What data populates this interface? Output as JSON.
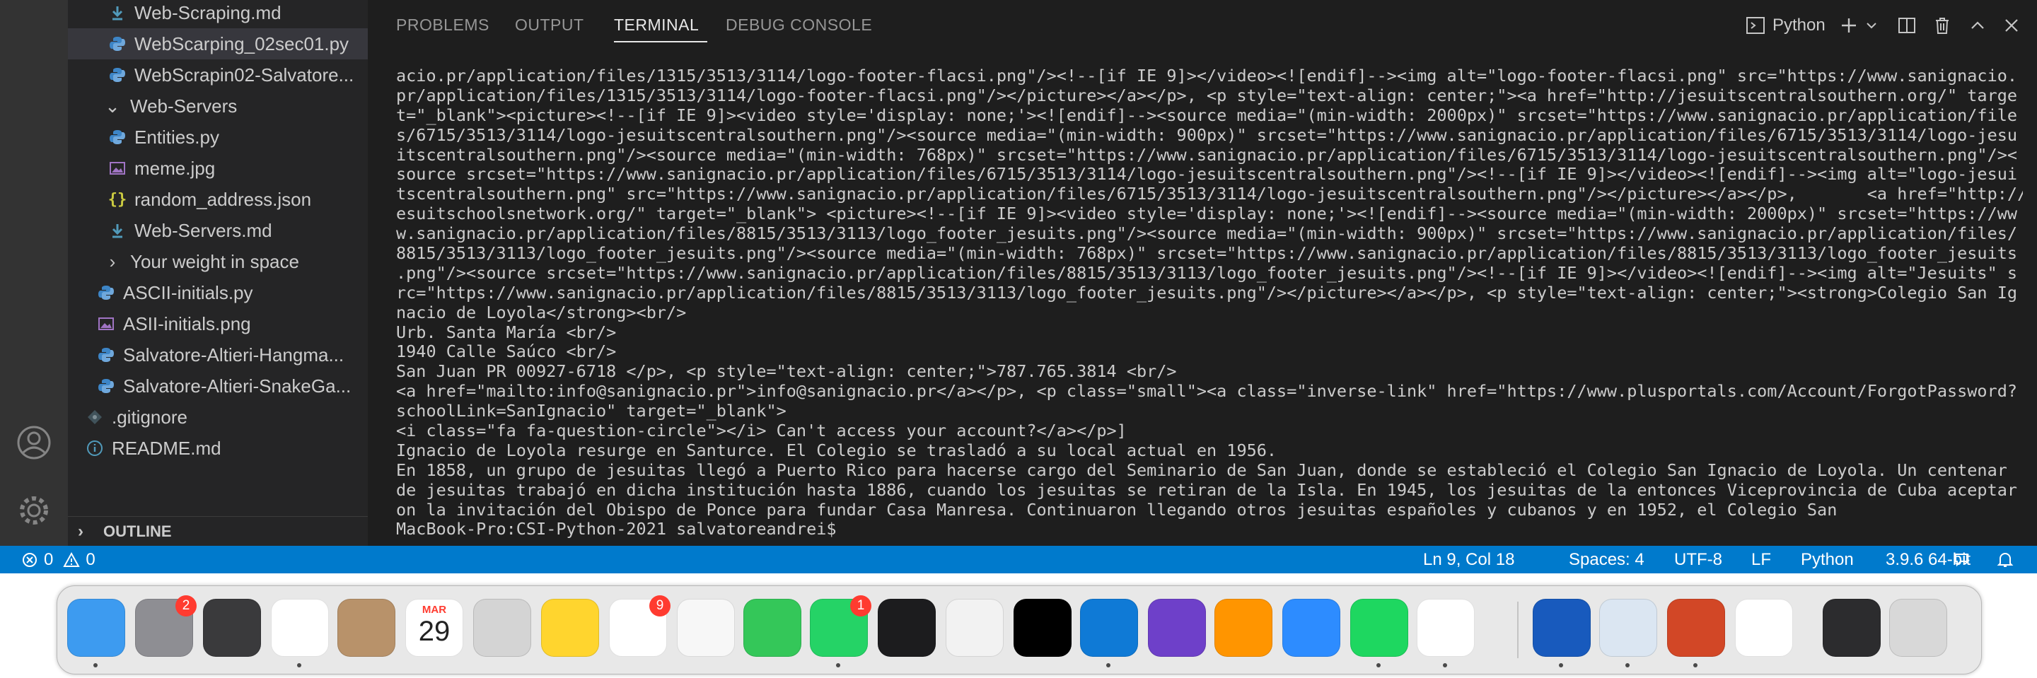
{
  "sidebar": {
    "rows": [
      {
        "label": "Web-Scraping.md",
        "icon": "markdown-file-icon",
        "kind": "file"
      },
      {
        "label": "WebScarping_02sec01.py",
        "icon": "python-file-icon",
        "kind": "file",
        "selected": true
      },
      {
        "label": "WebScrapin02-Salvatore...",
        "icon": "python-file-icon",
        "kind": "file"
      },
      {
        "label": "Web-Servers",
        "icon": "chevron-down-icon",
        "kind": "folder-open"
      },
      {
        "label": "Entities.py",
        "icon": "python-file-icon",
        "kind": "file"
      },
      {
        "label": "meme.jpg",
        "icon": "image-file-icon",
        "kind": "file"
      },
      {
        "label": "random_address.json",
        "icon": "json-file-icon",
        "kind": "file"
      },
      {
        "label": "Web-Servers.md",
        "icon": "markdown-file-icon",
        "kind": "file"
      },
      {
        "label": "Your weight in space",
        "icon": "chevron-right-icon",
        "kind": "folder-closed"
      },
      {
        "label": "ASCII-initials.py",
        "icon": "python-file-icon",
        "kind": "file"
      },
      {
        "label": "ASII-initials.png",
        "icon": "image-file-icon",
        "kind": "file"
      },
      {
        "label": "Salvatore-Altieri-Hangma...",
        "icon": "python-file-icon",
        "kind": "file"
      },
      {
        "label": "Salvatore-Altieri-SnakeGa...",
        "icon": "python-file-icon",
        "kind": "file"
      },
      {
        "label": ".gitignore",
        "icon": "gitignore-file-icon",
        "kind": "file"
      },
      {
        "label": "README.md",
        "icon": "info-file-icon",
        "kind": "file"
      }
    ],
    "outline_label": "OUTLINE"
  },
  "panel": {
    "tabs": [
      "PROBLEMS",
      "OUTPUT",
      "TERMINAL",
      "DEBUG CONSOLE"
    ],
    "active_tab": "TERMINAL",
    "terminal_profile": "Python"
  },
  "terminal": {
    "lines": [
      "acio.pr/application/files/1315/3513/3114/logo-footer-flacsi.png\"/><!--[if IE 9]></video><![endif]--><img alt=\"logo-footer-flacsi.png\" src=\"https://www.sanignacio.",
      "pr/application/files/1315/3513/3114/logo-footer-flacsi.png\"/></picture></a></p>, <p style=\"text-align: center;\"><a href=\"http://jesuitscentralsouthern.org/\" targe",
      "t=\"_blank\"><picture><!--[if IE 9]><video style='display: none;'><![endif]--><source media=\"(min-width: 2000px)\" srcset=\"https://www.sanignacio.pr/application/file",
      "s/6715/3513/3114/logo-jesuitscentralsouthern.png\"/><source media=\"(min-width: 900px)\" srcset=\"https://www.sanignacio.pr/application/files/6715/3513/3114/logo-jesu",
      "itscentralsouthern.png\"/><source media=\"(min-width: 768px)\" srcset=\"https://www.sanignacio.pr/application/files/6715/3513/3114/logo-jesuitscentralsouthern.png\"/><",
      "source srcset=\"https://www.sanignacio.pr/application/files/6715/3513/3114/logo-jesuitscentralsouthern.png\"/><!--[if IE 9]></video><![endif]--><img alt=\"logo-jesui",
      "tscentralsouthern.png\" src=\"https://www.sanignacio.pr/application/files/6715/3513/3114/logo-jesuitscentralsouthern.png\"/></picture></a></p>,       <a href=\"http://www.j",
      "esuitschoolsnetwork.org/\" target=\"_blank\"> <picture><!--[if IE 9]><video style='display: none;'><![endif]--><source media=\"(min-width: 2000px)\" srcset=\"https://ww",
      "w.sanignacio.pr/application/files/8815/3513/3113/logo_footer_jesuits.png\"/><source media=\"(min-width: 900px)\" srcset=\"https://www.sanignacio.pr/application/files/",
      "8815/3513/3113/logo_footer_jesuits.png\"/><source media=\"(min-width: 768px)\" srcset=\"https://www.sanignacio.pr/application/files/8815/3513/3113/logo_footer_jesuits",
      ".png\"/><source srcset=\"https://www.sanignacio.pr/application/files/8815/3513/3113/logo_footer_jesuits.png\"/><!--[if IE 9]></video><![endif]--><img alt=\"Jesuits\" s",
      "rc=\"https://www.sanignacio.pr/application/files/8815/3513/3113/logo_footer_jesuits.png\"/></picture></a></p>, <p style=\"text-align: center;\"><strong>Colegio San Ig",
      "nacio de Loyola</strong><br/>",
      "Urb. Santa María <br/>",
      "1940 Calle Saúco <br/>",
      "San Juan PR 00927-6718 </p>, <p style=\"text-align: center;\">787.765.3814 <br/>",
      "<a href=\"mailto:info@sanignacio.pr\">info@sanignacio.pr</a></p>, <p class=\"small\"><a class=\"inverse-link\" href=\"https://www.plusportals.com/Account/ForgotPassword?",
      "schoolLink=SanIgnacio\" target=\"_blank\">",
      "<i class=\"fa fa-question-circle\"></i> Can't access your account?</a></p>]",
      "Ignacio de Loyola resurge en Santurce. El Colegio se trasladó a su local actual en 1956.",
      "En 1858, un grupo de jesuitas llegó a Puerto Rico para hacerse cargo del Seminario de San Juan, donde se estableció el Colegio San Ignacio de Loyola. Un centenar",
      "de jesuitas trabajó en dicha institución hasta 1886, cuando los jesuitas se retiran de la Isla. En 1945, los jesuitas de la entonces Viceprovincia de Cuba aceptar",
      "on la invitación del Obispo de Ponce para fundar Casa Manresa. Continuaron llegando otros jesuitas españoles y cubanos y en 1952, el Colegio San",
      "MacBook-Pro:CSI-Python-2021 salvatoreandrei$ "
    ]
  },
  "statusbar": {
    "errors": "0",
    "warnings": "0",
    "position": "Ln 9, Col 18",
    "spaces": "Spaces: 4",
    "encoding": "UTF-8",
    "eol": "LF",
    "language": "Python",
    "interpreter": "3.9.6 64-bit"
  },
  "dock": {
    "apps": [
      {
        "name": "finder-icon",
        "color": "#3d9bf0",
        "running": true
      },
      {
        "name": "system-preferences-icon",
        "color": "#8e8e93",
        "badge": "2",
        "running": false
      },
      {
        "name": "garageband-icon",
        "color": "#3a3a3c",
        "running": false
      },
      {
        "name": "preview-icon",
        "color": "#ffffff",
        "running": true
      },
      {
        "name": "contacts-icon",
        "color": "#b8926a",
        "running": false
      },
      {
        "name": "calendar-icon",
        "color": "#ffffff",
        "month": "MAR",
        "day": "29",
        "running": false
      },
      {
        "name": "calculator-icon",
        "color": "#d4d4d4",
        "running": false
      },
      {
        "name": "notes-icon",
        "color": "#ffd52e",
        "running": false
      },
      {
        "name": "reminders-icon",
        "color": "#ffffff",
        "badge": "9",
        "running": false
      },
      {
        "name": "photos-icon",
        "color": "#f7f7f7",
        "running": false
      },
      {
        "name": "messages-icon",
        "color": "#34c759",
        "running": false
      },
      {
        "name": "whatsapp-icon",
        "color": "#25d366",
        "badge": "1",
        "running": true
      },
      {
        "name": "voice-memos-icon",
        "color": "#1c1c1e",
        "running": false
      },
      {
        "name": "pages-icon",
        "color": "#f2f2f2",
        "running": false
      },
      {
        "name": "tiktok-icon",
        "color": "#000000",
        "running": false
      },
      {
        "name": "vscode-icon",
        "color": "#0f7ad6",
        "running": true
      },
      {
        "name": "github-desktop-icon",
        "color": "#6e40c9",
        "running": false
      },
      {
        "name": "books-icon",
        "color": "#ff9500",
        "running": false
      },
      {
        "name": "zoom-icon",
        "color": "#2d8cff",
        "running": false
      },
      {
        "name": "spotify-icon",
        "color": "#1ed760",
        "running": true
      },
      {
        "name": "chrome-icon",
        "color": "#ffffff",
        "running": true
      },
      {
        "name": "word-icon",
        "color": "#185abd",
        "running": true
      },
      {
        "name": "preview-photo-icon",
        "color": "#dbe6f2",
        "running": true
      },
      {
        "name": "powerpoint-icon",
        "color": "#d24726",
        "running": true
      },
      {
        "name": "chrome-app-icon",
        "color": "#ffffff",
        "running": false
      },
      {
        "name": "downloads-stack-icon",
        "color": "#2c2c2e",
        "running": false
      },
      {
        "name": "trash-icon",
        "color": "#d8d8d8",
        "running": false
      }
    ]
  }
}
